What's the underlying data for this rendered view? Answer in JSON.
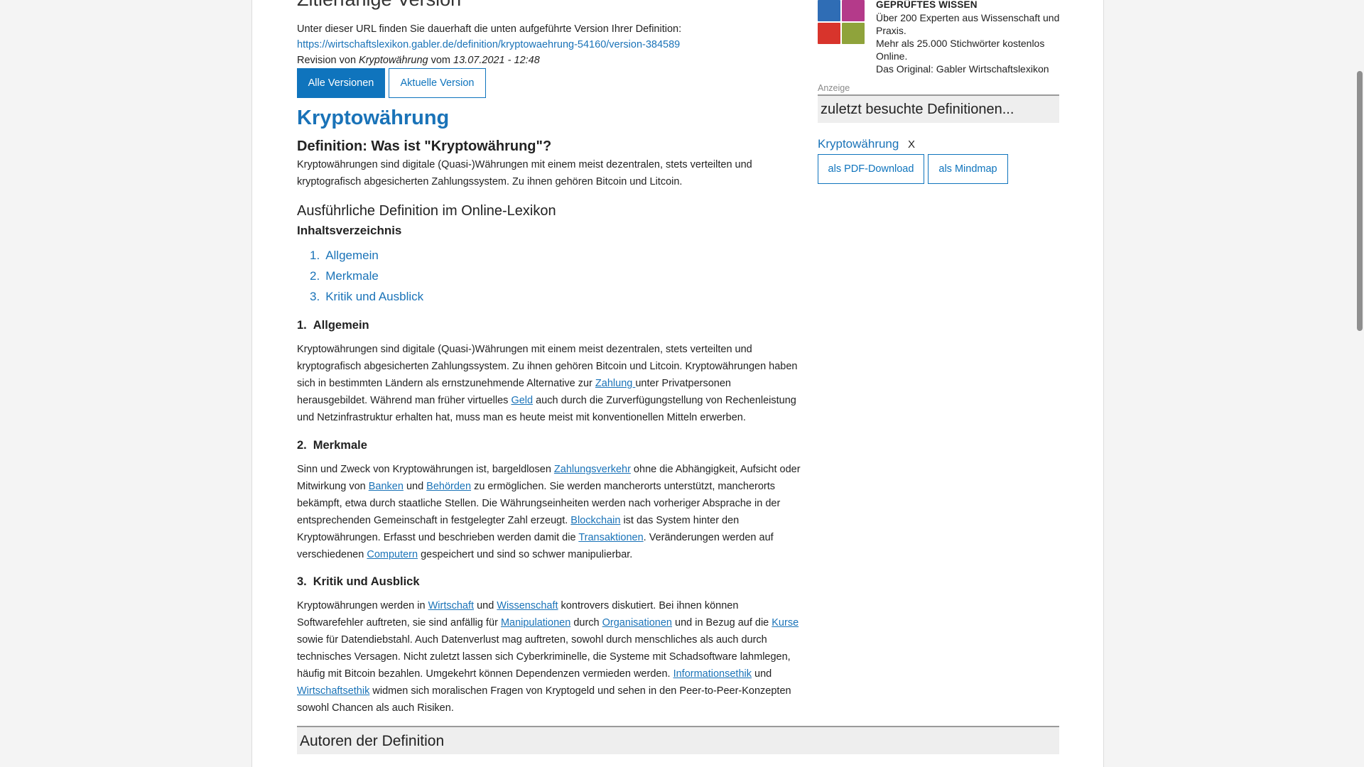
{
  "citation": {
    "title": "Zitierfähige Version",
    "text": "Unter dieser URL finden Sie dauerhaft die unten aufgeführte Version Ihrer Definition:",
    "url": "https://wirtschaftslexikon.gabler.de/definition/kryptowaehrung-54160/version-384589",
    "revision_prefix": "Revision von",
    "revision_term": "Kryptowährung",
    "revision_mid": "vom",
    "revision_date": "13.07.2021 - 12:48",
    "btn_all": "Alle Versionen",
    "btn_current": "Aktuelle Version"
  },
  "article": {
    "term": "Kryptowährung",
    "def_heading": "Definition: Was ist \"Kryptowährung\"?",
    "def_text": "Kryptowährungen sind digitale (Quasi-)Währungen mit einem meist dezentralen, stets verteilten und kryptografisch abgesicherten Zahlungssystem. Zu ihnen gehören Bitcoin und Litcoin.",
    "detail_heading": "Ausführliche Definition im Online-Lexikon",
    "toc_heading": "Inhaltsverzeichnis",
    "toc": [
      {
        "num": "1.",
        "label": "Allgemein"
      },
      {
        "num": "2.",
        "label": "Merkmale"
      },
      {
        "num": "3.",
        "label": "Kritik und Ausblick"
      }
    ],
    "sections": [
      {
        "num": "1.",
        "title": "Allgemein",
        "parts": [
          {
            "t": "Kryptowährungen sind digitale (Quasi-)Währungen mit einem meist dezentralen, stets verteilten und kryptografisch abgesicherten Zahlungssystem. Zu ihnen gehören Bitcoin und Litcoin. Kryptowährungen haben sich in bestimmten Ländern als ernstzunehmende Alternative zur "
          },
          {
            "link": "Zahlung "
          },
          {
            "t": "unter Privatpersonen herausgebildet. Während man früher virtuelles "
          },
          {
            "link": "Geld"
          },
          {
            "t": " auch durch die Zurverfügungstellung von Rechenleistung und Netzinfrastruktur erhalten hat, muss man es heute meist mit konventionellen Mitteln erwerben."
          }
        ]
      },
      {
        "num": "2.",
        "title": "Merkmale",
        "parts": [
          {
            "t": "Sinn und Zweck von Kryptowährungen ist, bargeldlosen "
          },
          {
            "link": "Zahlungsverkehr"
          },
          {
            "t": " ohne die Abhängigkeit, Aufsicht oder Mitwirkung von "
          },
          {
            "link": "Banken"
          },
          {
            "t": " und "
          },
          {
            "link": "Behörden"
          },
          {
            "t": " zu ermöglichen. Sie werden mancherorts unterstützt, mancherorts bekämpft, etwa durch staatliche Stellen. Die Währungseinheiten werden nach vorheriger Absprache in der entsprechenden Gemeinschaft in festgelegter Zahl erzeugt. "
          },
          {
            "link": "Blockchain"
          },
          {
            "t": " ist das System hinter den Kryptowährungen. Erfasst und beschrieben werden damit die "
          },
          {
            "link": "Transaktionen"
          },
          {
            "t": ". Veränderungen werden auf verschiedenen "
          },
          {
            "link": "Computern"
          },
          {
            "t": " gespeichert und sind so schwer manipulierbar."
          }
        ]
      },
      {
        "num": "3.",
        "title": "Kritik und Ausblick",
        "parts": [
          {
            "t": "Kryptowährungen werden in "
          },
          {
            "link": "Wirtschaft"
          },
          {
            "t": " und "
          },
          {
            "link": "Wissenschaft"
          },
          {
            "t": " kontrovers diskutiert. Bei ihnen können Softwarefehler auftreten, sie sind anfällig für "
          },
          {
            "link": "Manipulationen"
          },
          {
            "t": " durch "
          },
          {
            "link": "Organisationen"
          },
          {
            "t": " und in Bezug auf die "
          },
          {
            "link": "Kurse"
          },
          {
            "t": " sowie für Datendiebstahl. Auch Datenverlust mag auftreten, sowohl durch menschliches als auch durch technisches Versagen. Nicht zuletzt lassen sich Cyberkriminelle, die Systeme mit Schadsoftware lahmlegen, häufig mit Bitcoin bezahlen. Umgekehrt können Dependenzen vermieden werden. "
          },
          {
            "link": "Informationsethik"
          },
          {
            "t": " und "
          },
          {
            "link": "Wirtschaftsethik"
          },
          {
            "t": " widmen sich moralischen Fragen von Kryptogeld und sehen in den Peer-to-Peer-Konzepten sowohl Chancen als auch Risiken."
          }
        ]
      }
    ],
    "authors_heading": "Autoren der Definition"
  },
  "sidebar": {
    "promo_title": "GEPRÜFTES WISSEN",
    "promo_lines": [
      "Über 200 Experten aus Wissenschaft und Praxis.",
      "Mehr als 25.000 Stichwörter kostenlos Online.",
      "Das Original: Gabler Wirtschaftslexikon"
    ],
    "anzeige": "Anzeige",
    "recent_heading": "zuletzt besuchte Definitionen...",
    "recent_item": "Kryptowährung",
    "recent_remove": "X",
    "btn_pdf": "als PDF-Download",
    "btn_mindmap": "als Mindmap",
    "avatar_colors": [
      "#2f6db5",
      "#b43a8a",
      "#d8342c",
      "#8fa33b"
    ]
  }
}
